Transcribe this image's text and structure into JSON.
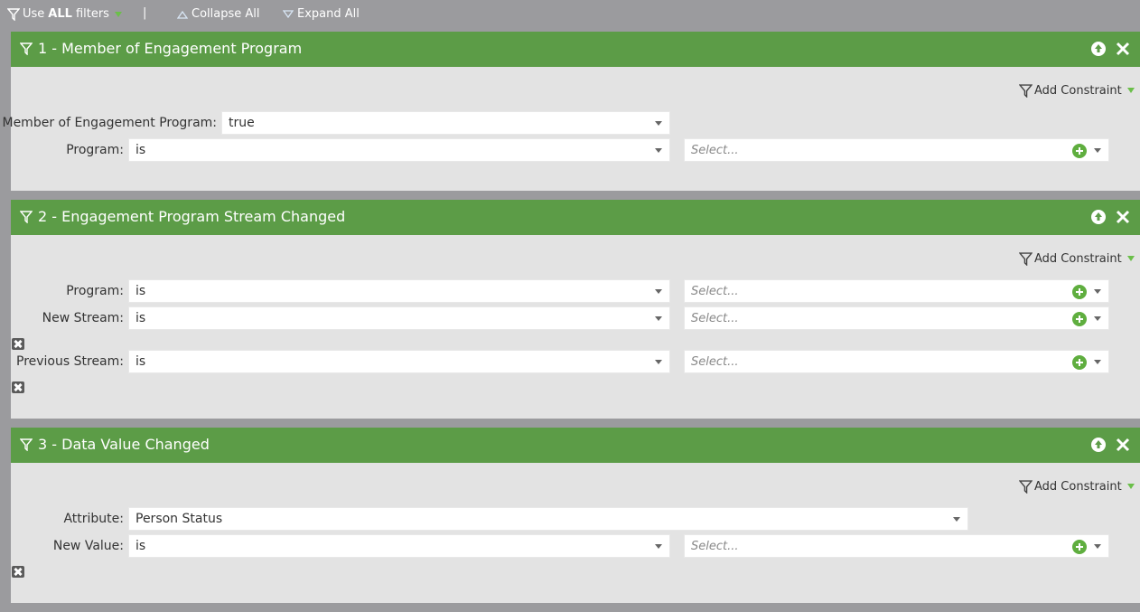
{
  "toolbar": {
    "use_prefix": "Use",
    "use_bold": "ALL",
    "use_suffix": "filters",
    "separator": "|",
    "collapse_all": "Collapse All",
    "expand_all": "Expand All"
  },
  "filters": [
    {
      "title": "1 - Member of Engagement Program",
      "add_constraint": "Add Constraint",
      "rows": [
        {
          "label": "Member of Engagement Program:",
          "operator": "true"
        },
        {
          "label": "Program:",
          "operator": "is",
          "value_placeholder": "Select..."
        }
      ]
    },
    {
      "title": "2 - Engagement Program Stream Changed",
      "add_constraint": "Add Constraint",
      "rows": [
        {
          "label": "Program:",
          "operator": "is",
          "value_placeholder": "Select..."
        },
        {
          "label": "New Stream:",
          "operator": "is",
          "value_placeholder": "Select..."
        },
        {
          "label": "Previous Stream:",
          "operator": "is",
          "value_placeholder": "Select..."
        }
      ]
    },
    {
      "title": "3 - Data Value Changed",
      "add_constraint": "Add Constraint",
      "rows": [
        {
          "label": "Attribute:",
          "operator": "Person Status"
        },
        {
          "label": "New Value:",
          "operator": "is",
          "value_placeholder": "Select..."
        }
      ]
    }
  ],
  "colors": {
    "toolbar_bg": "#9b9b9e",
    "panel_header": "#5c9c47",
    "panel_body": "#e3e3e3",
    "add_green": "#5fae3f"
  },
  "icons": {
    "filter": "funnel-icon",
    "move_up": "arrow-up-circle-icon",
    "remove": "close-x-icon",
    "add": "plus-circle-icon",
    "delete_constraint": "delete-box-icon"
  }
}
